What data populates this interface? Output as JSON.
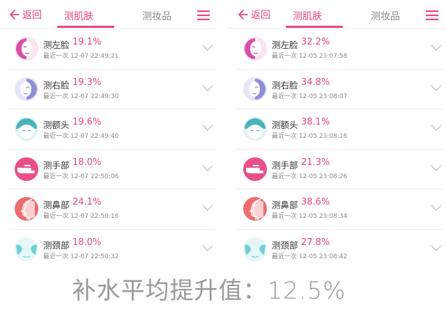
{
  "header": {
    "back_label": "返回",
    "tab_active": "测肌肤",
    "tab_inactive": "测妆品"
  },
  "left": {
    "items": [
      {
        "title": "测左脸",
        "percent": "19.1%",
        "time": "最近一次 12-07 22:49:21"
      },
      {
        "title": "测右脸",
        "percent": "19.3%",
        "time": "最近一次 12-07 22:49:30"
      },
      {
        "title": "测额头",
        "percent": "19.6%",
        "time": "最近一次 12-07 22:49:40"
      },
      {
        "title": "测手部",
        "percent": "18.0%",
        "time": "最近一次 12-07 22:50:06"
      },
      {
        "title": "测鼻部",
        "percent": "24.1%",
        "time": "最近一次 12-07 22:50:16"
      },
      {
        "title": "测颈部",
        "percent": "18.0%",
        "time": "最近一次 12-07 22:50:32"
      }
    ]
  },
  "right": {
    "items": [
      {
        "title": "测左脸",
        "percent": "32.2%",
        "time": "最近一次 12-05 23:07:58"
      },
      {
        "title": "测右脸",
        "percent": "34.8%",
        "time": "最近一次 12-05 23:08:07"
      },
      {
        "title": "测额头",
        "percent": "38.1%",
        "time": "最近一次 12-05 23:08:16"
      },
      {
        "title": "测手部",
        "percent": "21.3%",
        "time": "最近一次 12-05 23:08:26"
      },
      {
        "title": "测鼻部",
        "percent": "38.6%",
        "time": "最近一次 12-05 23:08:34"
      },
      {
        "title": "测颈部",
        "percent": "27.8%",
        "time": "最近一次 12-05 23:08:42"
      }
    ]
  },
  "summary": "补水平均提升值：12.5%",
  "colors": {
    "accent": "#e8457a",
    "left_face": "#d94fa8",
    "right_face": "#8e8fd6",
    "forehead": "#4bb3b8",
    "hand": "#ea4f8c",
    "nose": "#ee6b6f",
    "neck": "#6fd0d6"
  },
  "icons": [
    "left-face-icon",
    "right-face-icon",
    "forehead-icon",
    "hand-icon",
    "nose-icon",
    "neck-icon"
  ]
}
